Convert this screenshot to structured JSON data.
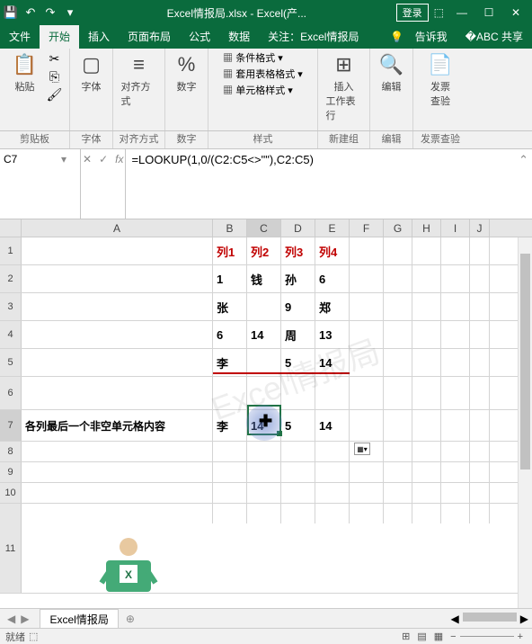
{
  "titlebar": {
    "filename": "Excel情报局.xlsx",
    "appname": "Excel(产...",
    "login": "登录"
  },
  "tabs": {
    "file": "文件",
    "home": "开始",
    "insert": "插入",
    "layout": "页面布局",
    "formulas": "公式",
    "data": "数据",
    "follow": "关注：Excel情报局",
    "tellme": "告诉我",
    "share": "共享"
  },
  "ribbon": {
    "paste": "粘贴",
    "font": "字体",
    "align": "对齐方式",
    "number": "数字",
    "condfmt": "条件格式",
    "tablefmt": "套用表格格式",
    "cellfmt": "单元格样式",
    "insert_btn": "插入",
    "worksheet_row": "工作表行",
    "edit": "编辑",
    "invoice": "发票",
    "invoice2": "查验"
  },
  "groups": {
    "clipboard": "剪贴板",
    "font": "字体",
    "align": "对齐方式",
    "number": "数字",
    "styles": "样式",
    "newgroup": "新建组",
    "edit": "编辑",
    "invoice": "发票查验"
  },
  "namebox": "C7",
  "formula": "=LOOKUP(1,0/(C2:C5<>\"\"),C2:C5)",
  "headers": {
    "A": "A",
    "B": "B",
    "C": "C",
    "D": "D",
    "E": "E",
    "F": "F",
    "G": "G",
    "H": "H",
    "I": "I",
    "J": "J"
  },
  "rownums": [
    "1",
    "2",
    "3",
    "4",
    "5",
    "6",
    "7",
    "8",
    "9",
    "10",
    "11"
  ],
  "cells": {
    "B1": "列1",
    "C1": "列2",
    "D1": "列3",
    "E1": "列4",
    "B2": "1",
    "C2": "钱",
    "D2": "孙",
    "E2": "6",
    "B3": "张",
    "C3": "",
    "D3": "9",
    "E3": "郑",
    "B4": "6",
    "C4": "14",
    "D4": "周",
    "E4": "13",
    "B5": "李",
    "C5": "",
    "D5": "5",
    "E5": "14",
    "A7": "各列最后一个非空单元格内容",
    "B7": "李",
    "C7": "14",
    "D7": "5",
    "E7": "14"
  },
  "sheet": "Excel情报局",
  "status": "就绪",
  "watermark": "Excel情报局"
}
